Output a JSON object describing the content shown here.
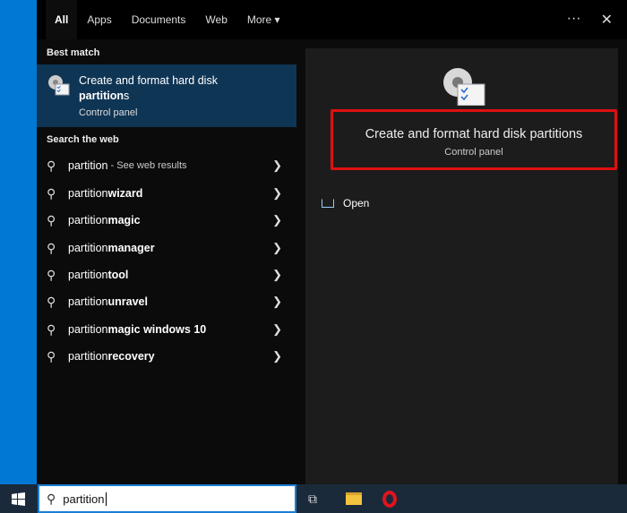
{
  "tabs": [
    {
      "label": "All"
    },
    {
      "label": "Apps"
    },
    {
      "label": "Documents"
    },
    {
      "label": "Web"
    },
    {
      "label": "More ▾"
    }
  ],
  "top_icons": {
    "more": "···",
    "close": "✕"
  },
  "best_match": {
    "heading": "Best match",
    "title_plain": "Create and format hard disk ",
    "title_bold": "partition",
    "title_tail": "s",
    "subtitle": "Control panel"
  },
  "web": {
    "heading": "Search the web",
    "items": [
      {
        "query": "partition",
        "bold": "",
        "hint": " - See web results"
      },
      {
        "query": "partition ",
        "bold": "wizard",
        "hint": ""
      },
      {
        "query": "partition ",
        "bold": "magic",
        "hint": ""
      },
      {
        "query": "partition ",
        "bold": "manager",
        "hint": ""
      },
      {
        "query": "partition ",
        "bold": "tool",
        "hint": ""
      },
      {
        "query": "partition ",
        "bold": "unravel",
        "hint": ""
      },
      {
        "query": "partition ",
        "bold": "magic windows 10",
        "hint": ""
      },
      {
        "query": "partition ",
        "bold": "recovery",
        "hint": ""
      }
    ]
  },
  "preview": {
    "title": "Create and format hard disk partitions",
    "subtitle": "Control panel",
    "open_label": "Open"
  },
  "taskbar": {
    "search_value": "partition"
  },
  "colors": {
    "highlight": "#0f3554",
    "accent": "#0078d4",
    "redbox": "#e01010"
  }
}
